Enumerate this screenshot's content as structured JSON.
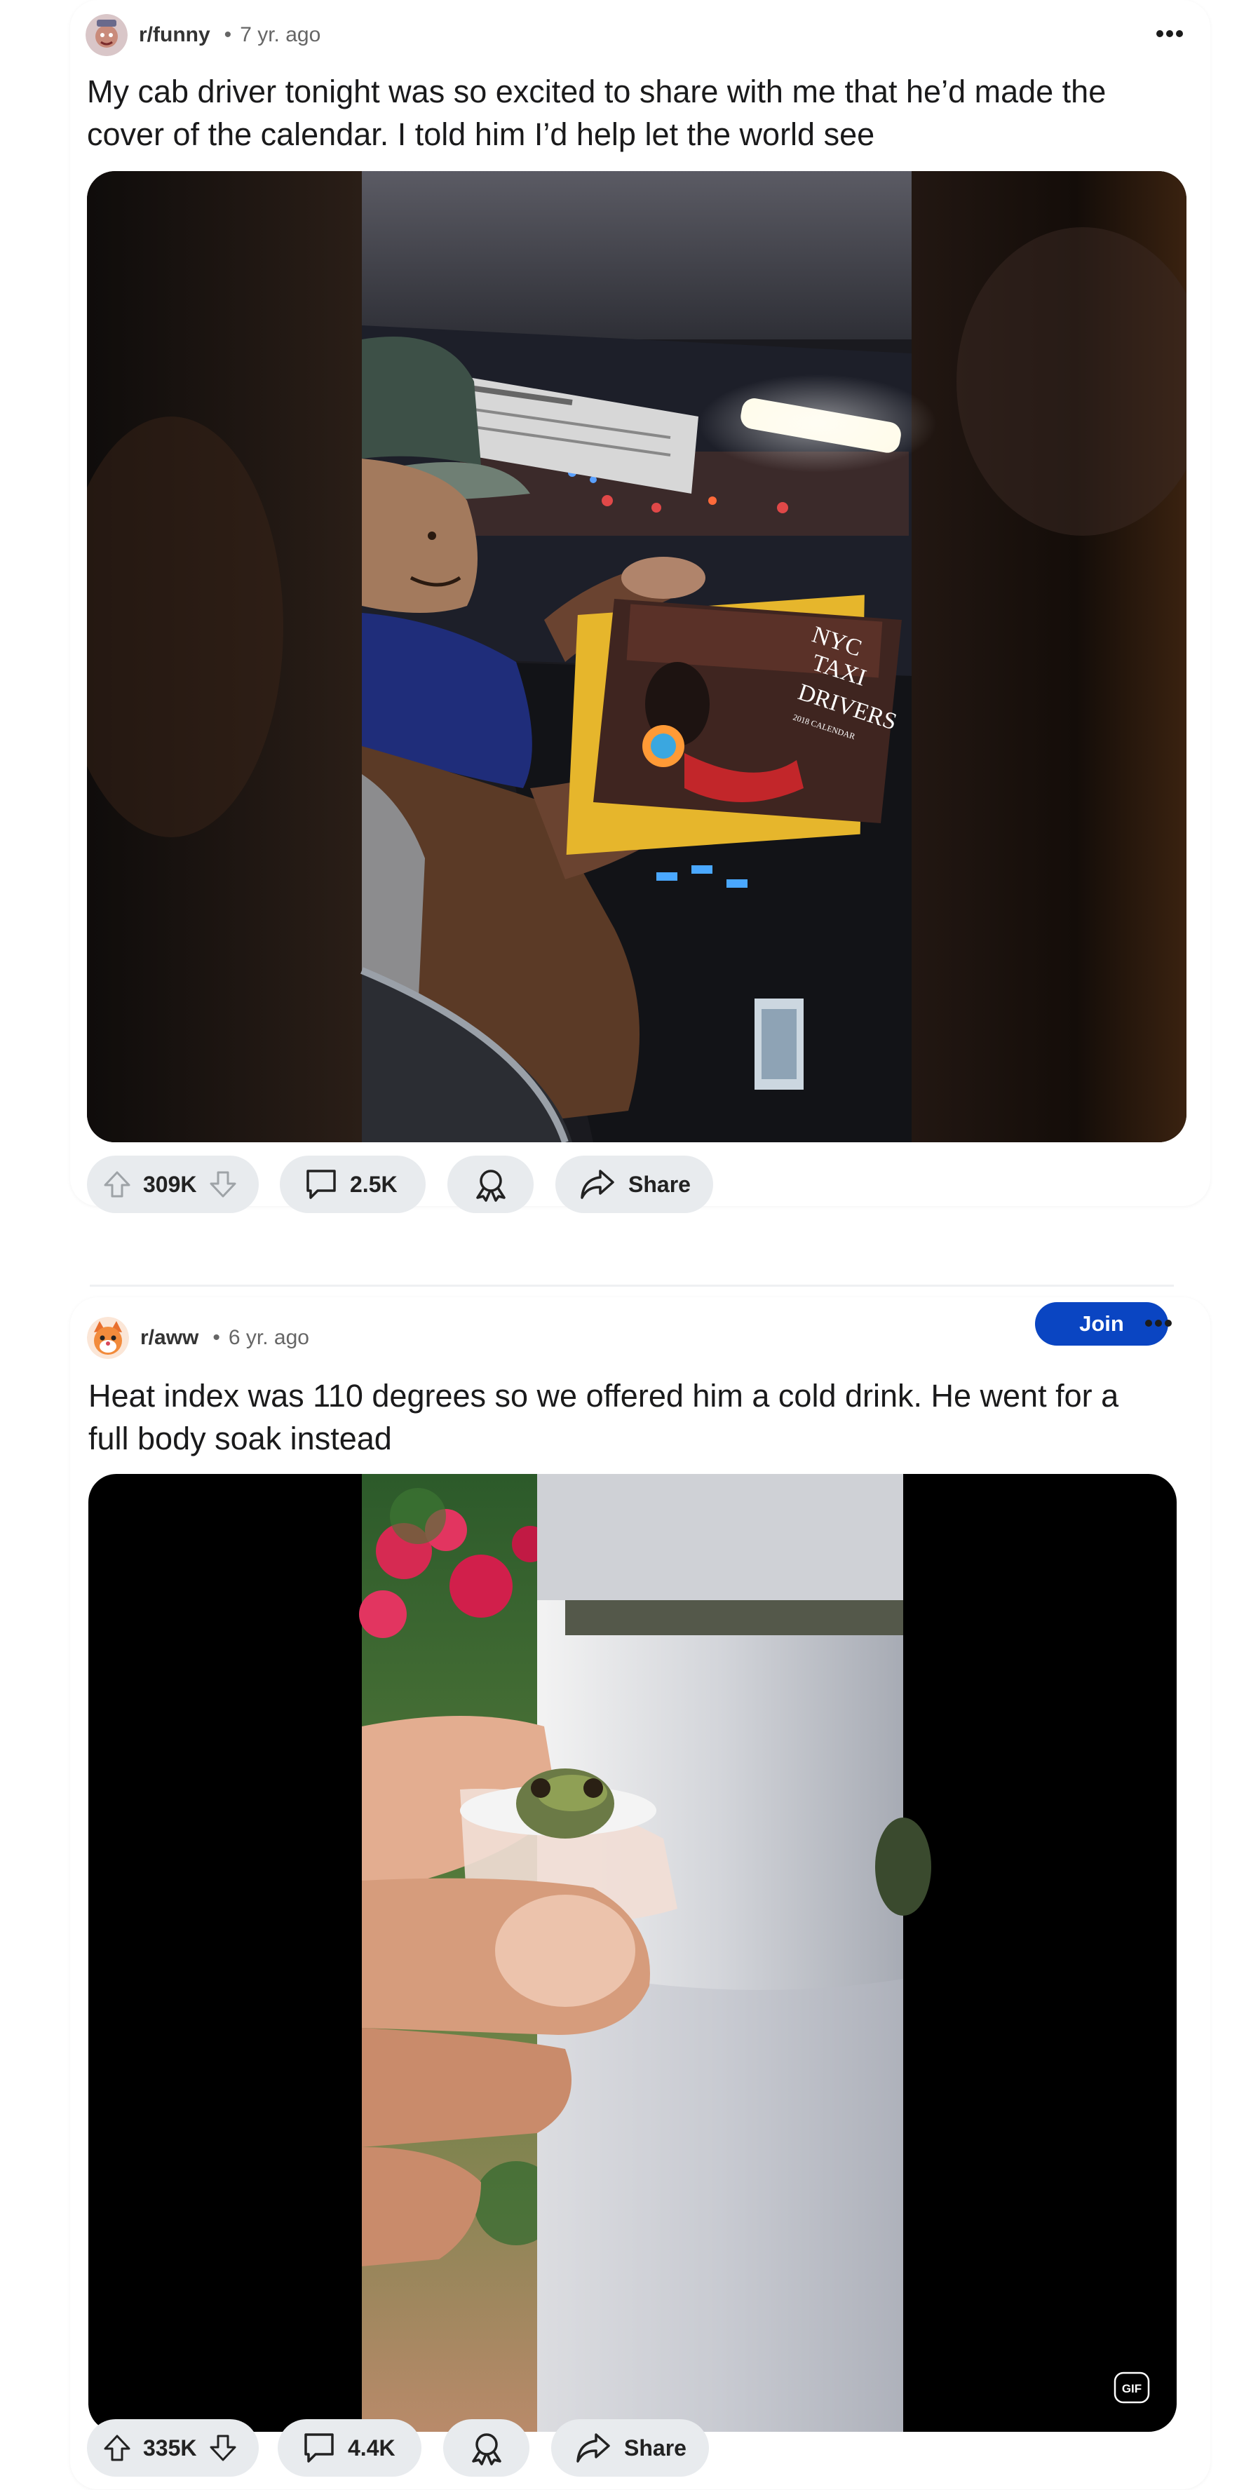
{
  "posts": [
    {
      "subreddit": "r/funny",
      "separator": "•",
      "age": "7 yr. ago",
      "title_line1": "My cab driver tonight was so excited to share with me that he’d made the",
      "title_line2": "cover of the calendar. I told him I’d help let the world see",
      "calendar_text": [
        "NYC",
        "TAXI",
        "DRIVERS",
        "2018 CALENDAR"
      ],
      "upvotes": "309K",
      "comments": "2.5K",
      "share_label": "Share"
    },
    {
      "subreddit": "r/aww",
      "separator": "•",
      "age": "6 yr. ago",
      "join_label": "Join",
      "title_line1": "Heat index was 110 degrees so we offered him a cold drink. He went for a",
      "title_line2": "full body soak instead",
      "gif_badge": "GIF",
      "upvotes": "335K",
      "comments": "4.4K",
      "share_label": "Share"
    }
  ],
  "colors": {
    "join": "#0a45c2",
    "pill_bg": "#e8ebee"
  },
  "icons": [
    "overflow-icon",
    "upvote-icon",
    "downvote-icon",
    "comment-icon",
    "award-icon",
    "share-icon",
    "gif-badge-icon"
  ]
}
